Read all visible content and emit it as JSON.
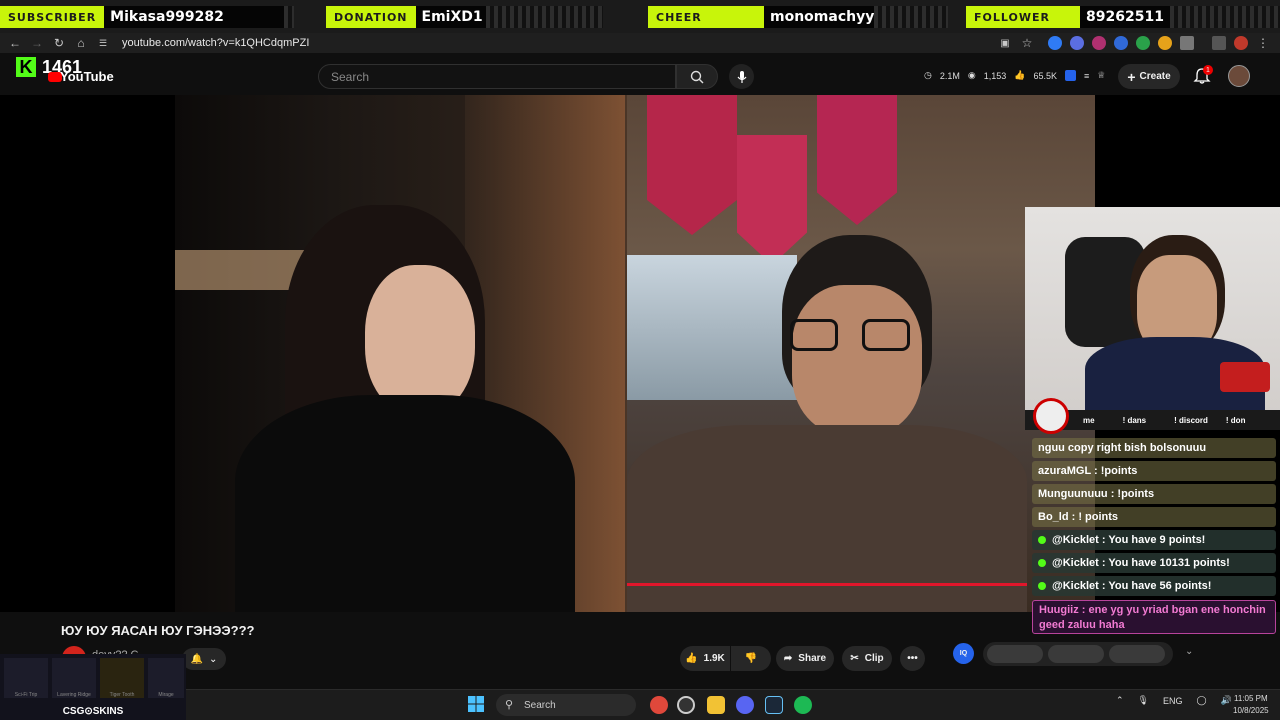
{
  "alerts": [
    {
      "label": "SUBSCRIBER",
      "name": "Mikasa999282"
    },
    {
      "label": "DONATION",
      "name": "EmiXD1"
    },
    {
      "label": "CHEER",
      "name": "monomachyy"
    },
    {
      "label": "FOLLOWER",
      "name": "89262511"
    }
  ],
  "browser": {
    "url": "youtube.com/watch?v=k1QHCdqmPZI"
  },
  "header": {
    "kick_count": "1461",
    "logo_text": "YouTube",
    "search_placeholder": "Search",
    "stats": {
      "views": "2.1M",
      "watching": "1,153",
      "likes": "65.5K"
    },
    "create_label": "Create",
    "notification_count": "1"
  },
  "stream_chat": {
    "commands": [
      "me",
      "! dans",
      "! discord",
      "! don"
    ],
    "messages": [
      {
        "text": "nguu copy right bish bolsonuuu",
        "style": "normal"
      },
      {
        "text": "azuraMGL : !points",
        "style": "normal"
      },
      {
        "text": "Munguunuuu : !points",
        "style": "normal"
      },
      {
        "text": "Bo_ld : ! points",
        "style": "normal"
      },
      {
        "text": "@Kicklet : You have 9 points!",
        "style": "bot"
      },
      {
        "text": "@Kicklet : You have 10131 points!",
        "style": "bot"
      },
      {
        "text": "@Kicklet : You have 56 points!",
        "style": "bot"
      },
      {
        "text": "Huugiiz : ene yg yu yriad bgan ene honchin geed zaluu haha",
        "style": "highlight"
      }
    ]
  },
  "video": {
    "title": "ЮУ ЮУ ЯАСАН ЮУ ГЭНЭЭ???",
    "channel_name": "devv?? C...",
    "likes": "1.9K",
    "share_label": "Share",
    "clip_label": "Clip",
    "more_label": "•••",
    "iq_label": "IQ"
  },
  "csgo_overlay": {
    "label": "CSG⊙SKINS",
    "items": [
      "Sci-Fi Trip",
      "Lavering Ridge",
      "Tiger Tooth",
      "Mirage"
    ]
  },
  "taskbar": {
    "search_label": "Search",
    "language": "ENG",
    "time": "11:05 PM",
    "date": "10/8/2025"
  },
  "colors": {
    "kick_green": "#53fc18",
    "alert_label_bg": "#c8f50a",
    "youtube_red": "#ff0000",
    "progress_red": "#e0162b"
  }
}
